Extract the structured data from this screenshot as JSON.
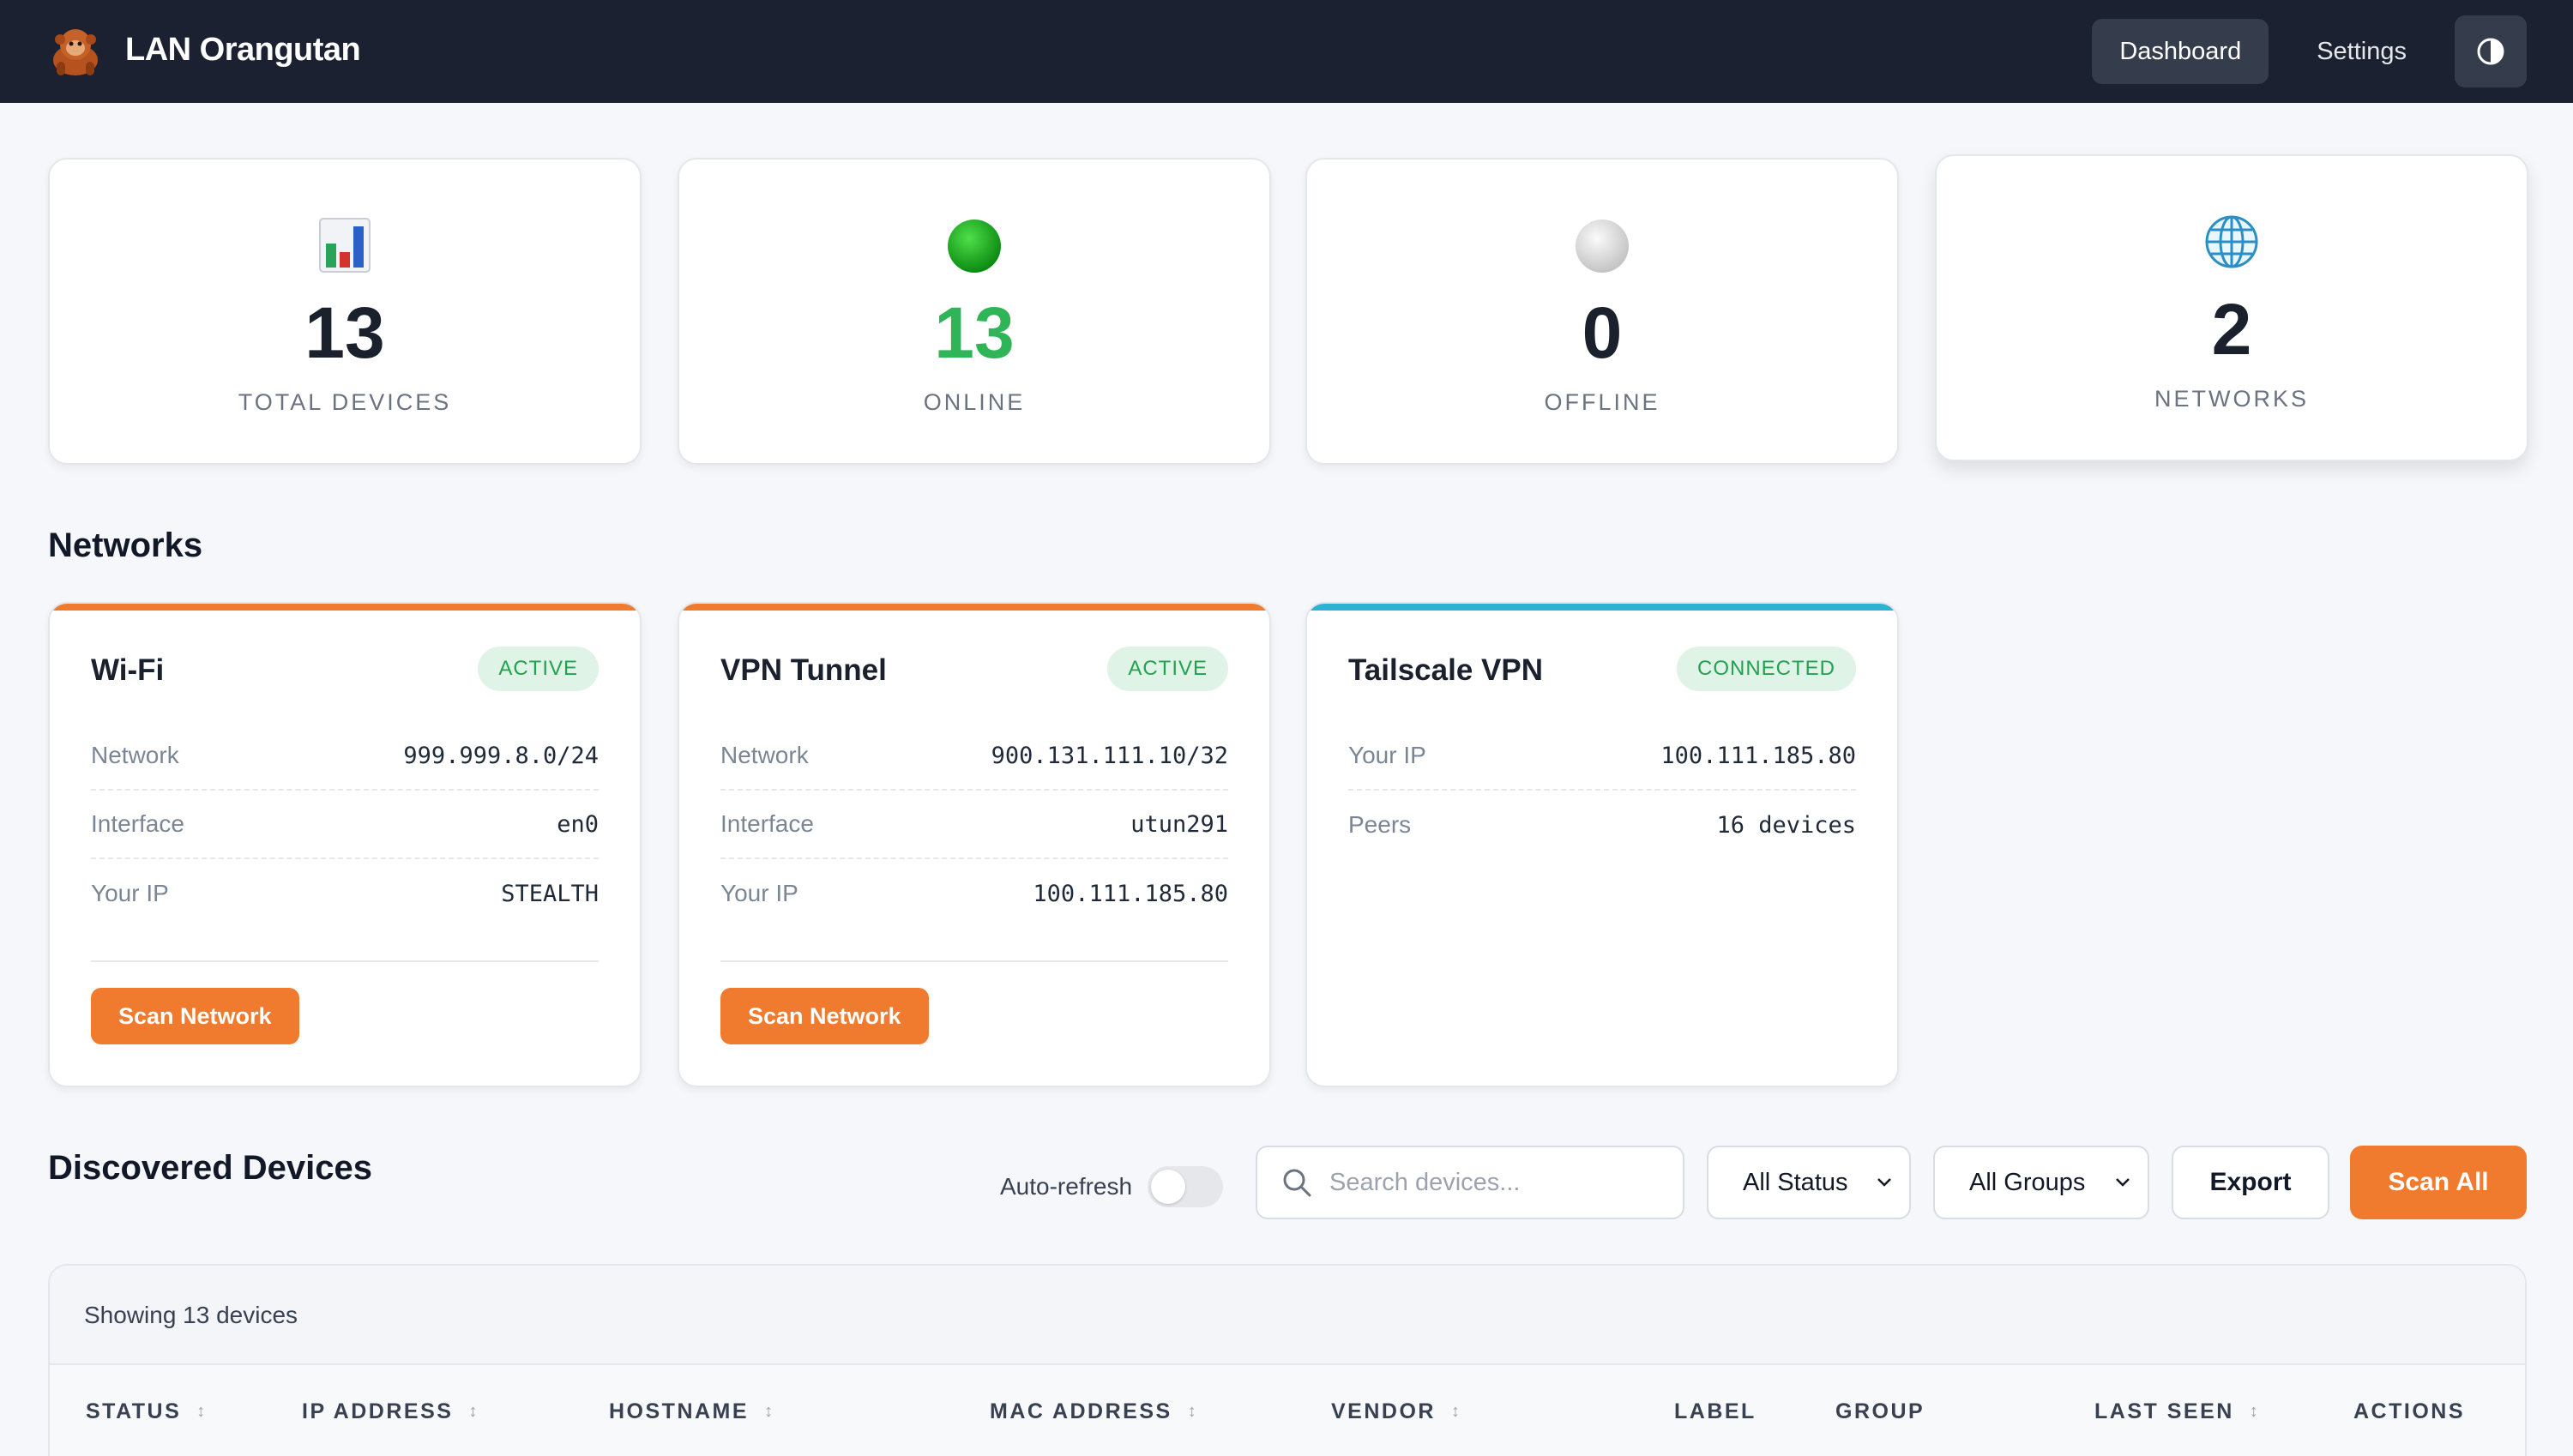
{
  "app": {
    "title": "LAN Orangutan"
  },
  "nav": {
    "dashboard": "Dashboard",
    "settings": "Settings"
  },
  "stats": [
    {
      "value": "13",
      "label": "TOTAL DEVICES",
      "icon": "bar-chart-icon",
      "color": "#111827"
    },
    {
      "value": "13",
      "label": "ONLINE",
      "icon": "green-circle-icon",
      "color": "#2fb457"
    },
    {
      "value": "0",
      "label": "OFFLINE",
      "icon": "grey-circle-icon",
      "color": "#111827"
    },
    {
      "value": "2",
      "label": "NETWORKS",
      "icon": "globe-icon",
      "color": "#111827"
    }
  ],
  "networks_title": "Networks",
  "networks": [
    {
      "name": "Wi-Fi",
      "badge": "ACTIVE",
      "rows": [
        {
          "key": "Network",
          "value": "999.999.8.0/24"
        },
        {
          "key": "Interface",
          "value": "en0"
        },
        {
          "key": "Your IP",
          "value": "STEALTH"
        }
      ],
      "button": "Scan Network"
    },
    {
      "name": "VPN Tunnel",
      "badge": "ACTIVE",
      "rows": [
        {
          "key": "Network",
          "value": "900.131.111.10/32"
        },
        {
          "key": "Interface",
          "value": "utun291"
        },
        {
          "key": "Your IP",
          "value": "100.111.185.80"
        }
      ],
      "button": "Scan Network"
    },
    {
      "name": "Tailscale VPN",
      "badge": "CONNECTED",
      "rows": [
        {
          "key": "Your IP",
          "value": "100.111.185.80"
        },
        {
          "key": "Peers",
          "value": "16 devices"
        }
      ]
    }
  ],
  "devices": {
    "title": "Discovered Devices",
    "auto_refresh": "Auto-refresh",
    "search_placeholder": "Search devices...",
    "status_filter": "All Status",
    "group_filter": "All Groups",
    "export": "Export",
    "scan_all": "Scan All",
    "showing": "Showing 13 devices",
    "columns": [
      "STATUS",
      "IP ADDRESS",
      "HOSTNAME",
      "MAC ADDRESS",
      "VENDOR",
      "LABEL",
      "GROUP",
      "LAST SEEN",
      "ACTIONS"
    ]
  },
  "colors": {
    "accent": "#f07a2d",
    "header_bg": "#1b2130",
    "tailscale": "#2db3d1",
    "success": "#22a150"
  }
}
